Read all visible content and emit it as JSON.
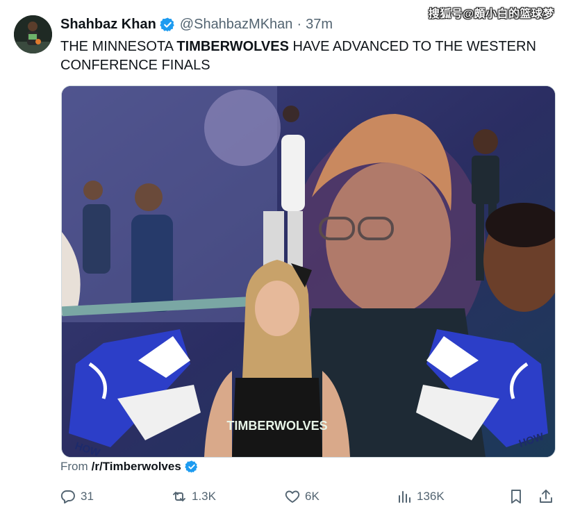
{
  "watermark": "搜狐号@頗小白的篮球梦",
  "tweet": {
    "author_name": "Shahbaz Khan",
    "author_handle": "@ShahbazMKhan",
    "separator": "·",
    "time": "37m",
    "text_before": "THE MINNESOTA ",
    "text_bold": "TIMBERWOLVES",
    "text_after": " HAVE ADVANCED TO THE WESTERN CONFERENCE FINALS",
    "verified_color": "#1d9bf0"
  },
  "media": {
    "jersey_text": "TIMBERWOLVES",
    "corner_text": "HOW"
  },
  "source": {
    "from_label": "From",
    "source_name": "/r/Timberwolves"
  },
  "actions": {
    "replies": "31",
    "reposts": "1.3K",
    "likes": "6K",
    "views": "136K"
  },
  "icons": [
    "verified-badge-icon",
    "reply-icon",
    "repost-icon",
    "like-icon",
    "views-icon",
    "bookmark-icon",
    "share-icon"
  ]
}
